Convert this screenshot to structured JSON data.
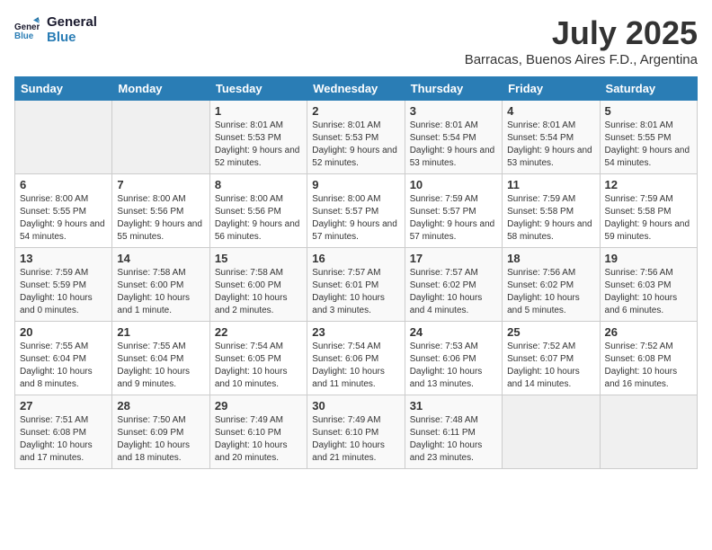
{
  "logo": {
    "line1": "General",
    "line2": "Blue"
  },
  "title": "July 2025",
  "location": "Barracas, Buenos Aires F.D., Argentina",
  "weekdays": [
    "Sunday",
    "Monday",
    "Tuesday",
    "Wednesday",
    "Thursday",
    "Friday",
    "Saturday"
  ],
  "weeks": [
    [
      {
        "day": "",
        "sunrise": "",
        "sunset": "",
        "daylight": ""
      },
      {
        "day": "",
        "sunrise": "",
        "sunset": "",
        "daylight": ""
      },
      {
        "day": "1",
        "sunrise": "Sunrise: 8:01 AM",
        "sunset": "Sunset: 5:53 PM",
        "daylight": "Daylight: 9 hours and 52 minutes."
      },
      {
        "day": "2",
        "sunrise": "Sunrise: 8:01 AM",
        "sunset": "Sunset: 5:53 PM",
        "daylight": "Daylight: 9 hours and 52 minutes."
      },
      {
        "day": "3",
        "sunrise": "Sunrise: 8:01 AM",
        "sunset": "Sunset: 5:54 PM",
        "daylight": "Daylight: 9 hours and 53 minutes."
      },
      {
        "day": "4",
        "sunrise": "Sunrise: 8:01 AM",
        "sunset": "Sunset: 5:54 PM",
        "daylight": "Daylight: 9 hours and 53 minutes."
      },
      {
        "day": "5",
        "sunrise": "Sunrise: 8:01 AM",
        "sunset": "Sunset: 5:55 PM",
        "daylight": "Daylight: 9 hours and 54 minutes."
      }
    ],
    [
      {
        "day": "6",
        "sunrise": "Sunrise: 8:00 AM",
        "sunset": "Sunset: 5:55 PM",
        "daylight": "Daylight: 9 hours and 54 minutes."
      },
      {
        "day": "7",
        "sunrise": "Sunrise: 8:00 AM",
        "sunset": "Sunset: 5:56 PM",
        "daylight": "Daylight: 9 hours and 55 minutes."
      },
      {
        "day": "8",
        "sunrise": "Sunrise: 8:00 AM",
        "sunset": "Sunset: 5:56 PM",
        "daylight": "Daylight: 9 hours and 56 minutes."
      },
      {
        "day": "9",
        "sunrise": "Sunrise: 8:00 AM",
        "sunset": "Sunset: 5:57 PM",
        "daylight": "Daylight: 9 hours and 57 minutes."
      },
      {
        "day": "10",
        "sunrise": "Sunrise: 7:59 AM",
        "sunset": "Sunset: 5:57 PM",
        "daylight": "Daylight: 9 hours and 57 minutes."
      },
      {
        "day": "11",
        "sunrise": "Sunrise: 7:59 AM",
        "sunset": "Sunset: 5:58 PM",
        "daylight": "Daylight: 9 hours and 58 minutes."
      },
      {
        "day": "12",
        "sunrise": "Sunrise: 7:59 AM",
        "sunset": "Sunset: 5:58 PM",
        "daylight": "Daylight: 9 hours and 59 minutes."
      }
    ],
    [
      {
        "day": "13",
        "sunrise": "Sunrise: 7:59 AM",
        "sunset": "Sunset: 5:59 PM",
        "daylight": "Daylight: 10 hours and 0 minutes."
      },
      {
        "day": "14",
        "sunrise": "Sunrise: 7:58 AM",
        "sunset": "Sunset: 6:00 PM",
        "daylight": "Daylight: 10 hours and 1 minute."
      },
      {
        "day": "15",
        "sunrise": "Sunrise: 7:58 AM",
        "sunset": "Sunset: 6:00 PM",
        "daylight": "Daylight: 10 hours and 2 minutes."
      },
      {
        "day": "16",
        "sunrise": "Sunrise: 7:57 AM",
        "sunset": "Sunset: 6:01 PM",
        "daylight": "Daylight: 10 hours and 3 minutes."
      },
      {
        "day": "17",
        "sunrise": "Sunrise: 7:57 AM",
        "sunset": "Sunset: 6:02 PM",
        "daylight": "Daylight: 10 hours and 4 minutes."
      },
      {
        "day": "18",
        "sunrise": "Sunrise: 7:56 AM",
        "sunset": "Sunset: 6:02 PM",
        "daylight": "Daylight: 10 hours and 5 minutes."
      },
      {
        "day": "19",
        "sunrise": "Sunrise: 7:56 AM",
        "sunset": "Sunset: 6:03 PM",
        "daylight": "Daylight: 10 hours and 6 minutes."
      }
    ],
    [
      {
        "day": "20",
        "sunrise": "Sunrise: 7:55 AM",
        "sunset": "Sunset: 6:04 PM",
        "daylight": "Daylight: 10 hours and 8 minutes."
      },
      {
        "day": "21",
        "sunrise": "Sunrise: 7:55 AM",
        "sunset": "Sunset: 6:04 PM",
        "daylight": "Daylight: 10 hours and 9 minutes."
      },
      {
        "day": "22",
        "sunrise": "Sunrise: 7:54 AM",
        "sunset": "Sunset: 6:05 PM",
        "daylight": "Daylight: 10 hours and 10 minutes."
      },
      {
        "day": "23",
        "sunrise": "Sunrise: 7:54 AM",
        "sunset": "Sunset: 6:06 PM",
        "daylight": "Daylight: 10 hours and 11 minutes."
      },
      {
        "day": "24",
        "sunrise": "Sunrise: 7:53 AM",
        "sunset": "Sunset: 6:06 PM",
        "daylight": "Daylight: 10 hours and 13 minutes."
      },
      {
        "day": "25",
        "sunrise": "Sunrise: 7:52 AM",
        "sunset": "Sunset: 6:07 PM",
        "daylight": "Daylight: 10 hours and 14 minutes."
      },
      {
        "day": "26",
        "sunrise": "Sunrise: 7:52 AM",
        "sunset": "Sunset: 6:08 PM",
        "daylight": "Daylight: 10 hours and 16 minutes."
      }
    ],
    [
      {
        "day": "27",
        "sunrise": "Sunrise: 7:51 AM",
        "sunset": "Sunset: 6:08 PM",
        "daylight": "Daylight: 10 hours and 17 minutes."
      },
      {
        "day": "28",
        "sunrise": "Sunrise: 7:50 AM",
        "sunset": "Sunset: 6:09 PM",
        "daylight": "Daylight: 10 hours and 18 minutes."
      },
      {
        "day": "29",
        "sunrise": "Sunrise: 7:49 AM",
        "sunset": "Sunset: 6:10 PM",
        "daylight": "Daylight: 10 hours and 20 minutes."
      },
      {
        "day": "30",
        "sunrise": "Sunrise: 7:49 AM",
        "sunset": "Sunset: 6:10 PM",
        "daylight": "Daylight: 10 hours and 21 minutes."
      },
      {
        "day": "31",
        "sunrise": "Sunrise: 7:48 AM",
        "sunset": "Sunset: 6:11 PM",
        "daylight": "Daylight: 10 hours and 23 minutes."
      },
      {
        "day": "",
        "sunrise": "",
        "sunset": "",
        "daylight": ""
      },
      {
        "day": "",
        "sunrise": "",
        "sunset": "",
        "daylight": ""
      }
    ]
  ]
}
